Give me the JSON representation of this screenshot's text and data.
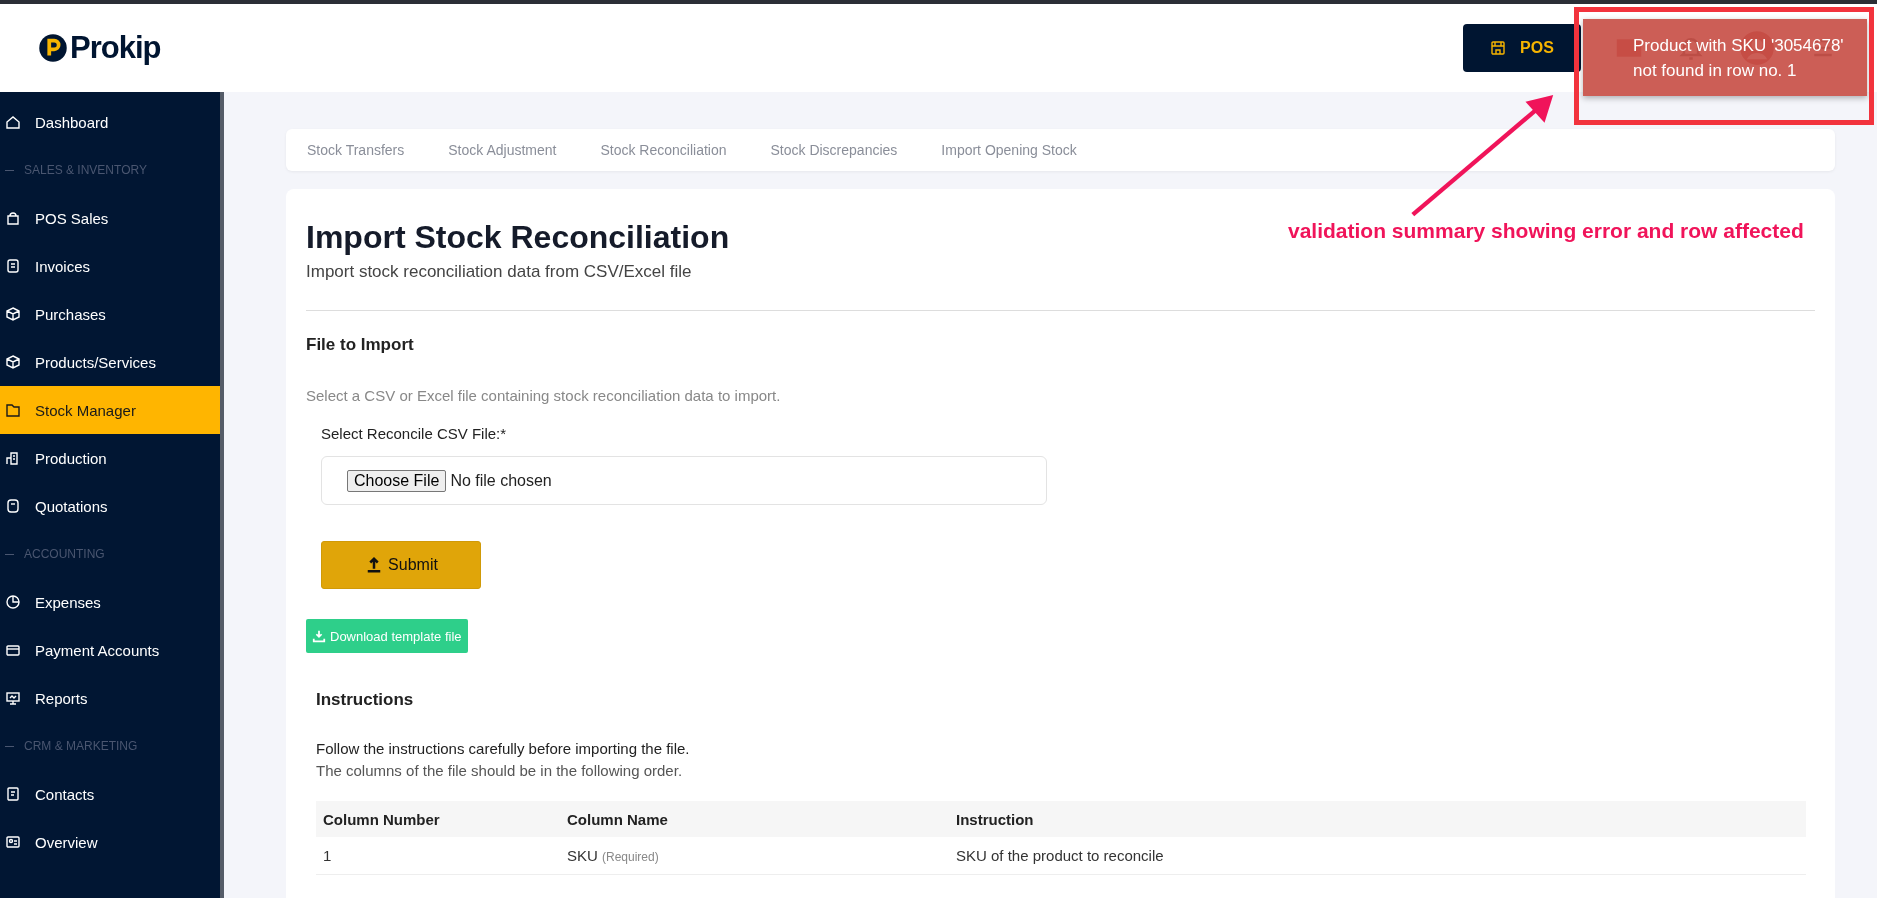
{
  "header": {
    "logo": "Prokip",
    "pos_button": "POS"
  },
  "toast": {
    "message": "Product with SKU '3054678' not found in row no. 1"
  },
  "sidebar": {
    "items": [
      {
        "kind": "item",
        "label": "Dashboard",
        "selected": false
      },
      {
        "kind": "section",
        "label": "SALES & INVENTORY"
      },
      {
        "kind": "item",
        "label": "POS Sales",
        "selected": false
      },
      {
        "kind": "item",
        "label": "Invoices",
        "selected": false
      },
      {
        "kind": "item",
        "label": "Purchases",
        "selected": false
      },
      {
        "kind": "item",
        "label": "Products/Services",
        "selected": false
      },
      {
        "kind": "item",
        "label": "Stock Manager",
        "selected": true
      },
      {
        "kind": "item",
        "label": "Production",
        "selected": false
      },
      {
        "kind": "item",
        "label": "Quotations",
        "selected": false
      },
      {
        "kind": "section",
        "label": "ACCOUNTING"
      },
      {
        "kind": "item",
        "label": "Expenses",
        "selected": false
      },
      {
        "kind": "item",
        "label": "Payment Accounts",
        "selected": false
      },
      {
        "kind": "item",
        "label": "Reports",
        "selected": false
      },
      {
        "kind": "section",
        "label": "CRM & MARKETING"
      },
      {
        "kind": "item",
        "label": "Contacts",
        "selected": false
      },
      {
        "kind": "item",
        "label": "Overview",
        "selected": false
      }
    ]
  },
  "tabs": [
    {
      "label": "Stock Transfers",
      "selected": false
    },
    {
      "label": "Stock Adjustment",
      "selected": false
    },
    {
      "label": "Stock Reconciliation",
      "selected": false
    },
    {
      "label": "Stock Discrepancies",
      "selected": false
    },
    {
      "label": "Import Opening Stock",
      "selected": false
    }
  ],
  "page": {
    "title": "Import Stock Reconciliation",
    "subtitle": "Import stock reconciliation data from CSV/Excel file",
    "section_title": "File to Import",
    "helper": "Select a CSV or Excel file containing stock reconciliation data to import.",
    "field_label": "Select Reconcile CSV File:*",
    "choose_button": "Choose File",
    "file_status": "No file chosen",
    "submit_button": "Submit",
    "download_button": "Download template file",
    "instructions_title": "Instructions",
    "instructions_lead": "Follow the instructions carefully before importing the file.",
    "instructions_note": "The columns of the file should be in the following order."
  },
  "table": {
    "columns": [
      "Column Number",
      "Column Name",
      "Instruction"
    ],
    "rows": [
      {
        "number": "1",
        "name": "SKU",
        "note": "(Required)",
        "instruction": "SKU of the product to reconcile"
      }
    ]
  },
  "annotation": {
    "text": "validation summary showing error and row affected"
  }
}
